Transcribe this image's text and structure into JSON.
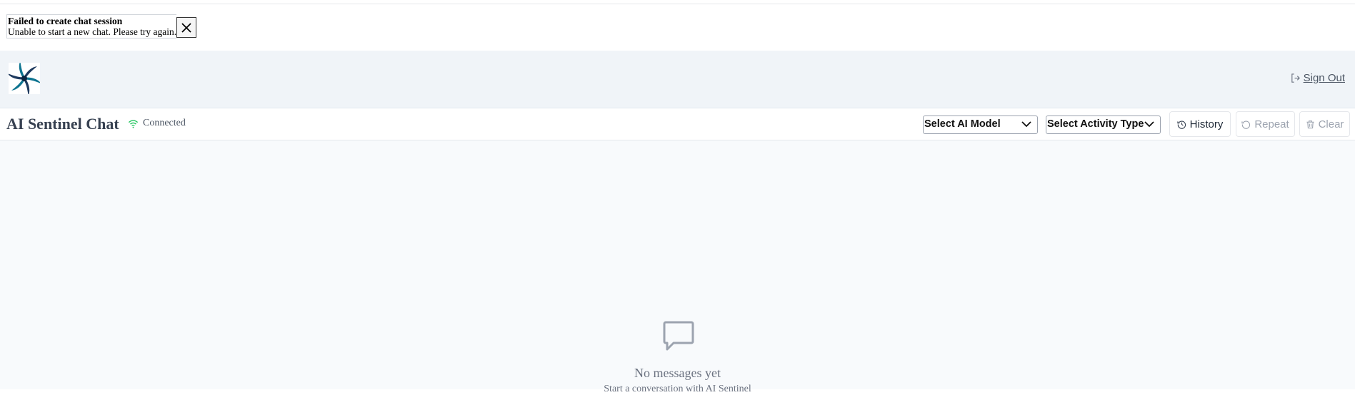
{
  "toast": {
    "title": "Failed to create chat session",
    "message": "Unable to start a new chat. Please try again."
  },
  "header": {
    "logo_icon": "swirl-logo-icon",
    "sign_out_label": "Sign Out"
  },
  "chat": {
    "title": "AI Sentinel Chat",
    "connection_status": "Connected",
    "connection_color": "#22c55e",
    "model_select": {
      "selected": "Select AI Model"
    },
    "activity_select": {
      "selected": "Select Activity Type"
    },
    "history_label": "History",
    "repeat_label": "Repeat",
    "clear_label": "Clear"
  },
  "empty_state": {
    "icon": "message-square-icon",
    "title": "No messages yet",
    "subtitle": "Start a conversation with AI Sentinel"
  }
}
